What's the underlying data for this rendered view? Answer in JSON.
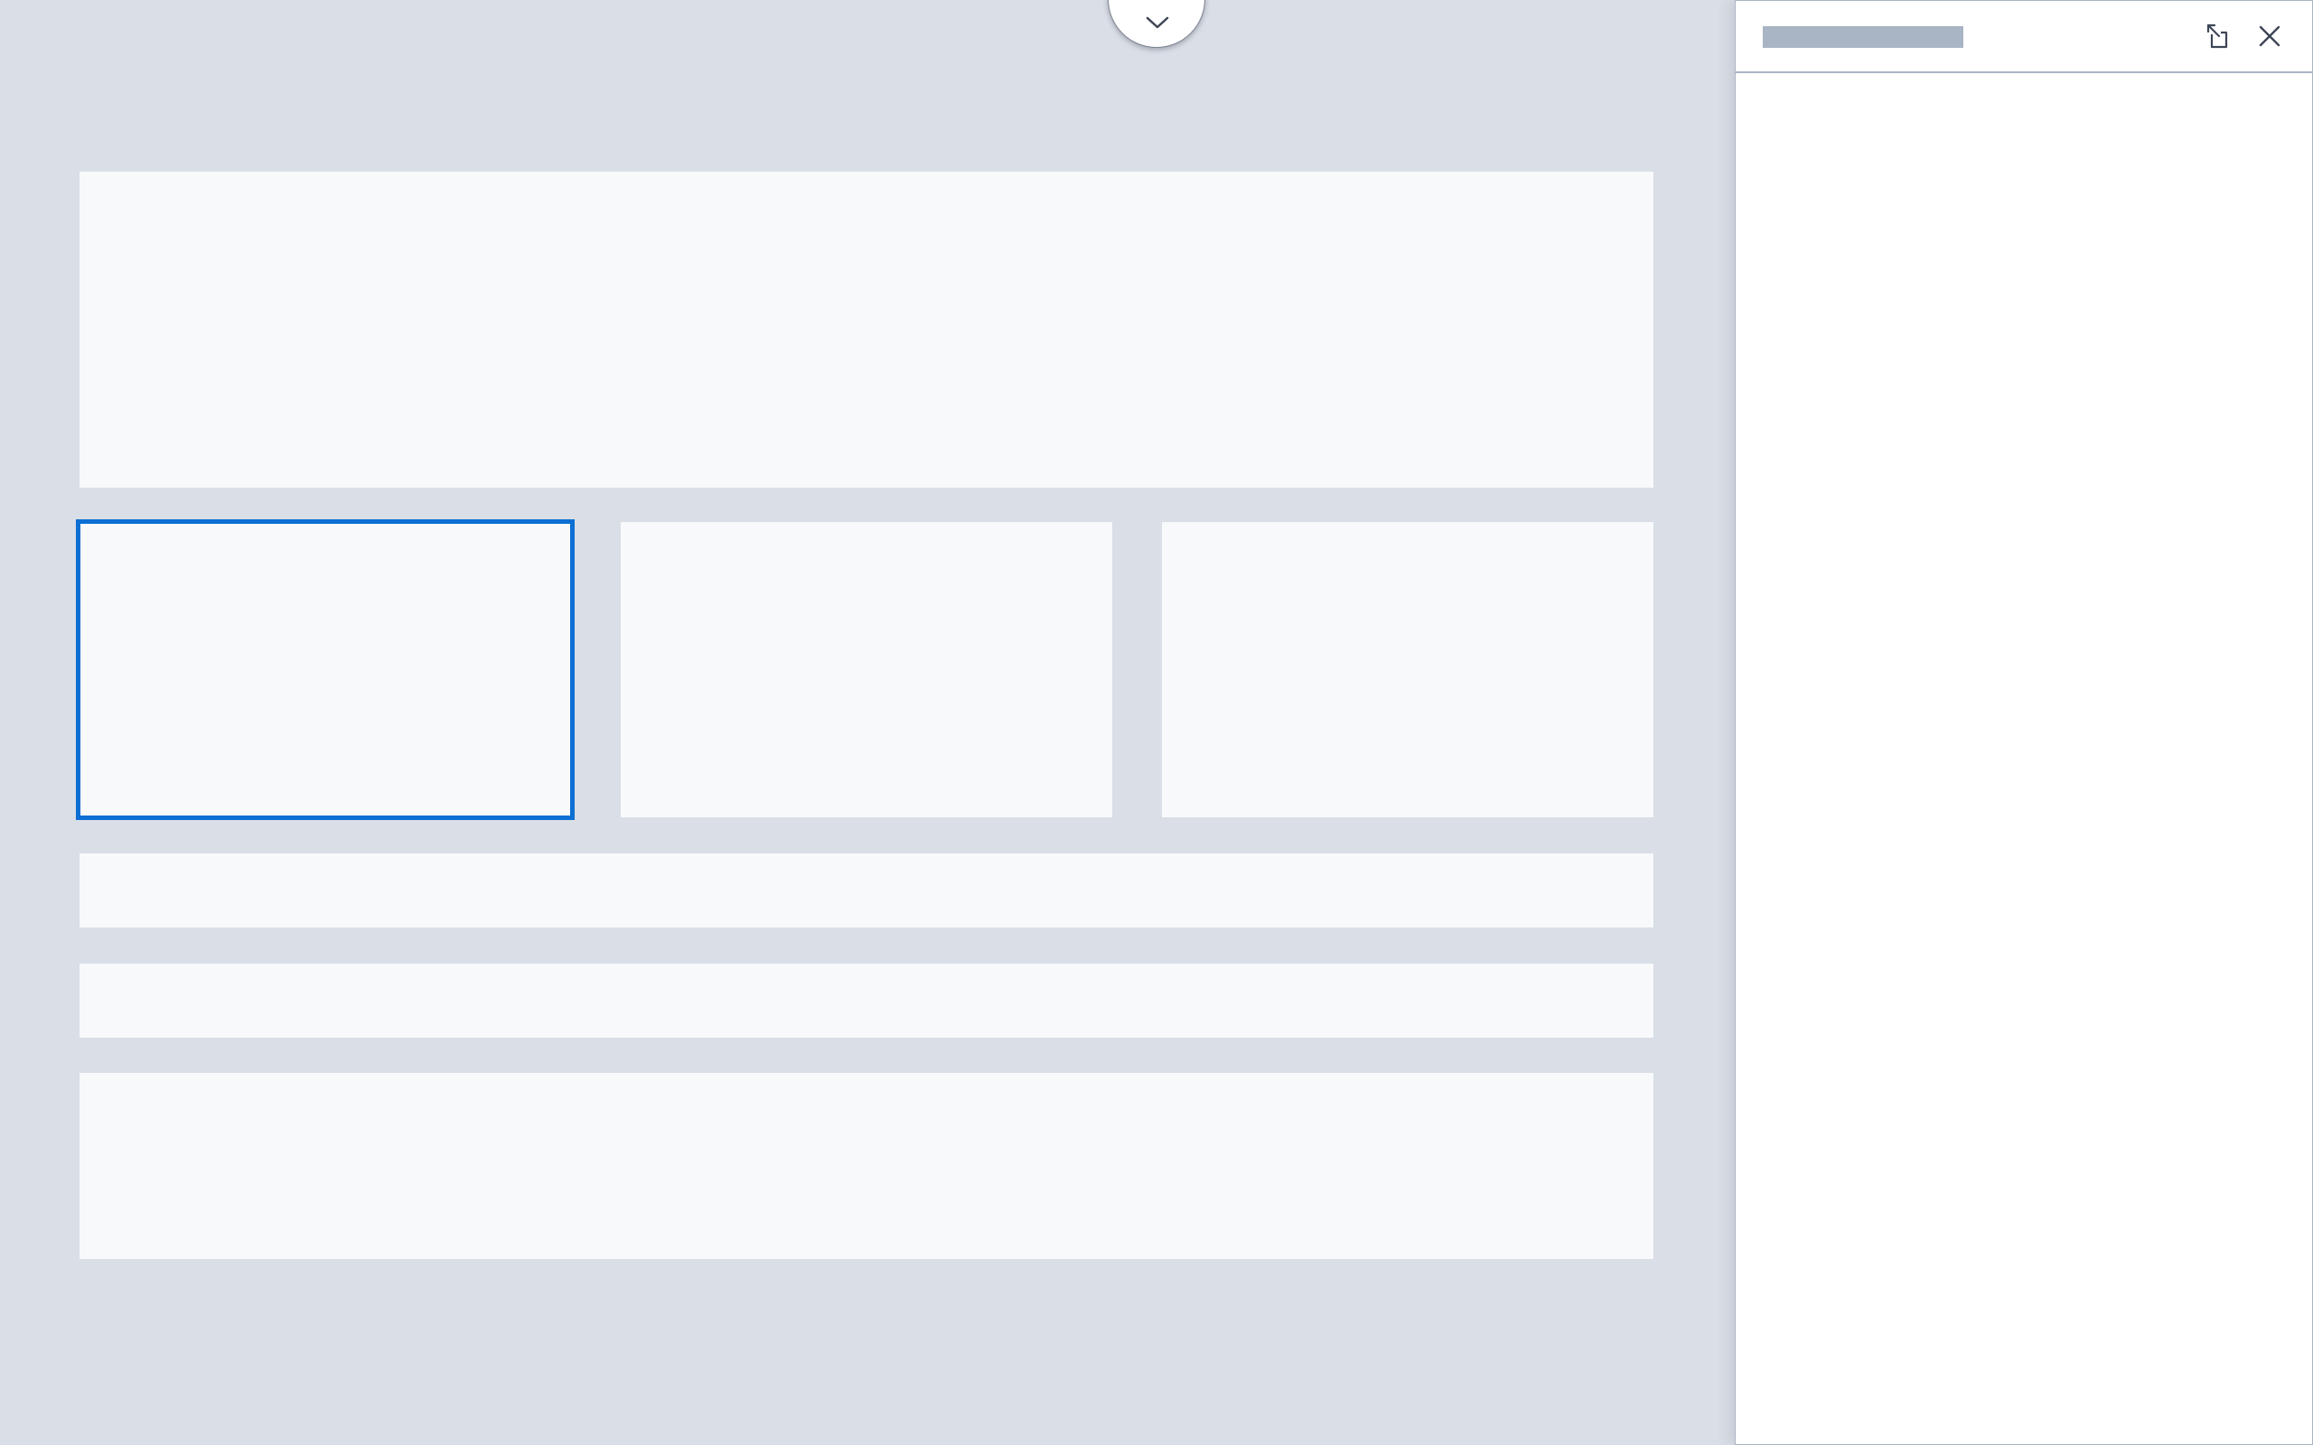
{
  "colors": {
    "canvas_background": "#DADEE6",
    "block_background": "#F7F9FB",
    "selection_accent": "#0B6FD3",
    "panel_background": "#FFFFFF",
    "panel_border": "#A9B4C4",
    "icon_color": "#3E4656"
  },
  "canvas": {
    "collapse_toggle": {
      "icon": "chevron-down-icon"
    },
    "blocks": [
      {
        "name": "hero-block",
        "selected": false
      },
      {
        "name": "card-block-1",
        "selected": true
      },
      {
        "name": "card-block-2",
        "selected": false
      },
      {
        "name": "card-block-3",
        "selected": false
      },
      {
        "name": "strip-block-1",
        "selected": false
      },
      {
        "name": "strip-block-2",
        "selected": false
      },
      {
        "name": "footer-block",
        "selected": false
      }
    ]
  },
  "side_panel": {
    "title": "",
    "popout_icon": "open-in-new-window-icon",
    "close_icon": "close-icon"
  }
}
